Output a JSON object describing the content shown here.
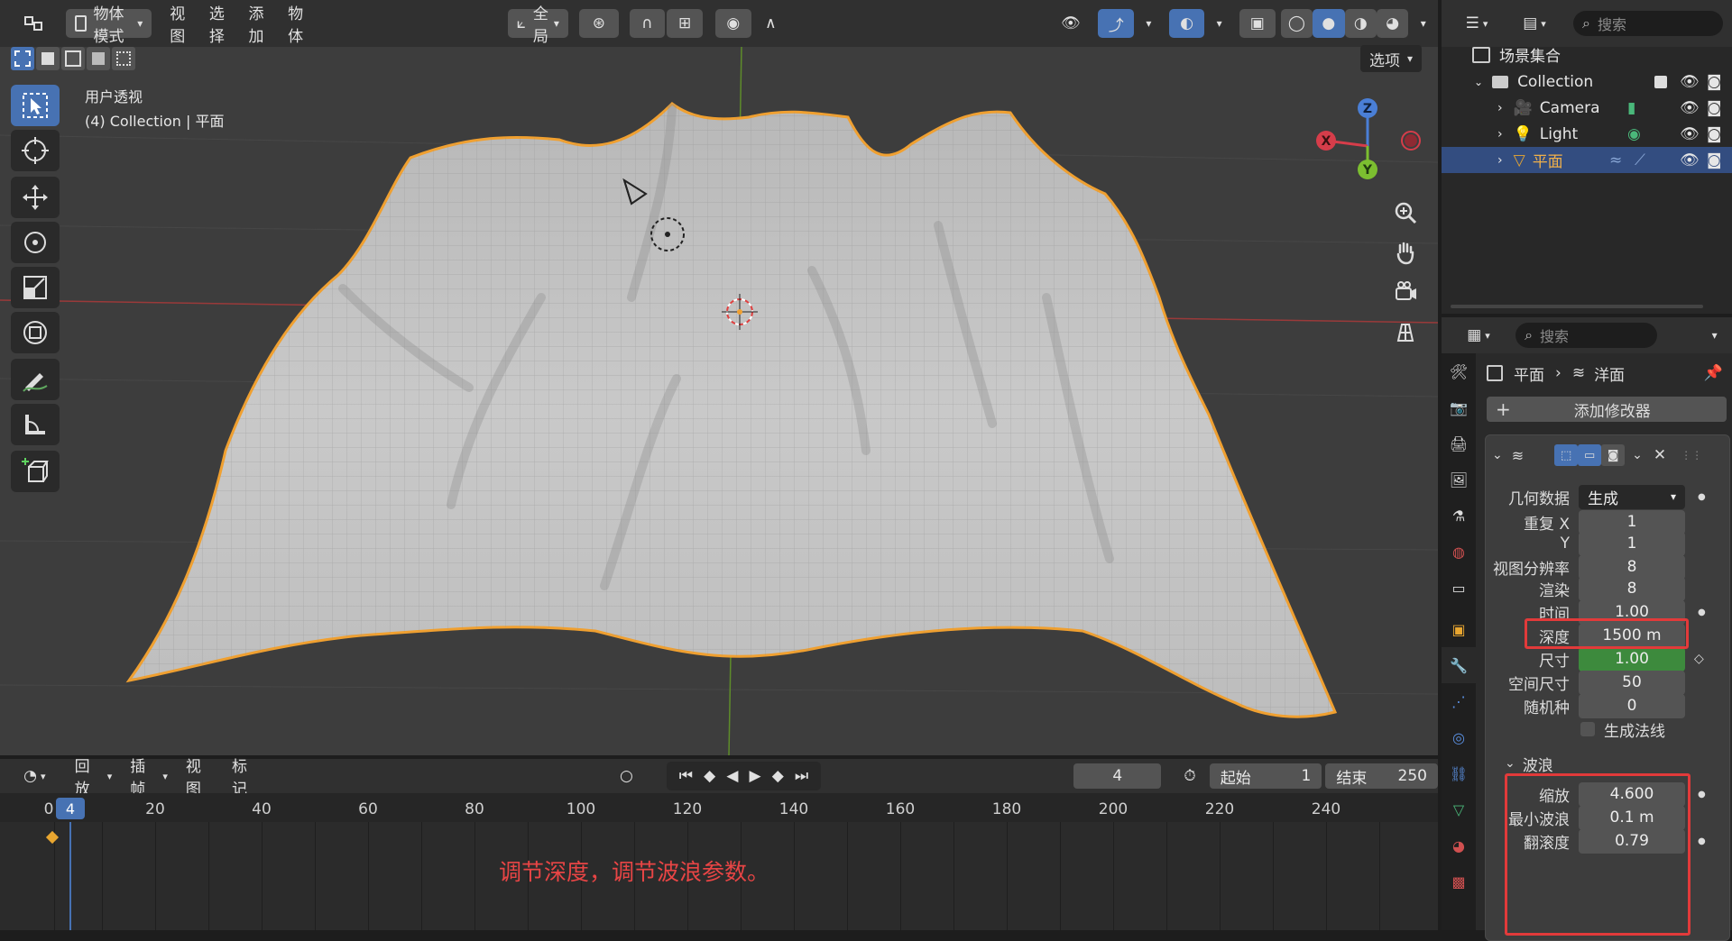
{
  "viewport": {
    "mode_label": "物体模式",
    "menus": [
      "视图",
      "选择",
      "添加",
      "物体"
    ],
    "transform_orientation": "全局",
    "options_label": "选项",
    "view_name": "用户透视",
    "collection_info": "(4) Collection | 平面",
    "gizmo": {
      "z": "Z",
      "x": "X",
      "y": "Y"
    }
  },
  "timeline": {
    "menus": [
      "回放",
      "插帧",
      "视图",
      "标记"
    ],
    "current_frame": "4",
    "start_label": "起始",
    "start_value": "1",
    "end_label": "结束",
    "end_value": "250",
    "ticks": [
      "0",
      "20",
      "40",
      "60",
      "80",
      "100",
      "120",
      "140",
      "160",
      "180",
      "200",
      "220",
      "240"
    ],
    "playhead_label": "4",
    "annotation": "调节深度，调节波浪参数。"
  },
  "outliner": {
    "search_placeholder": "搜索",
    "root": "场景集合",
    "collection": "Collection",
    "items": [
      {
        "label": "Camera"
      },
      {
        "label": "Light"
      },
      {
        "label": "平面"
      }
    ]
  },
  "properties": {
    "search_placeholder": "搜索",
    "breadcrumb_object": "平面",
    "breadcrumb_modifier": "洋面",
    "add_modifier": "添加修改器",
    "geometry_label": "几何数据",
    "geometry_value": "生成",
    "fields": [
      {
        "label": "重复 X",
        "value": "1"
      },
      {
        "label": "Y",
        "value": "1"
      },
      {
        "label": "视图分辨率",
        "value": "8"
      },
      {
        "label": "渲染",
        "value": "8"
      },
      {
        "label": "时间",
        "value": "1.00"
      },
      {
        "label": "深度",
        "value": "1500 m"
      },
      {
        "label": "尺寸",
        "value": "1.00"
      },
      {
        "label": "空间尺寸",
        "value": "50"
      },
      {
        "label": "随机种",
        "value": "0"
      }
    ],
    "generate_normals": "生成法线",
    "waves_section": "波浪",
    "wave_fields": [
      {
        "label": "缩放",
        "value": "4.600"
      },
      {
        "label": "最小波浪",
        "value": "0.1 m"
      },
      {
        "label": "翻滚度",
        "value": "0.79"
      }
    ]
  },
  "colors": {
    "accent": "#4772b3",
    "selection_outline": "#f0a030",
    "highlight_box": "#e23a3a",
    "annotation_text": "#e84545",
    "keyframe_green": "#3d8a3d"
  }
}
